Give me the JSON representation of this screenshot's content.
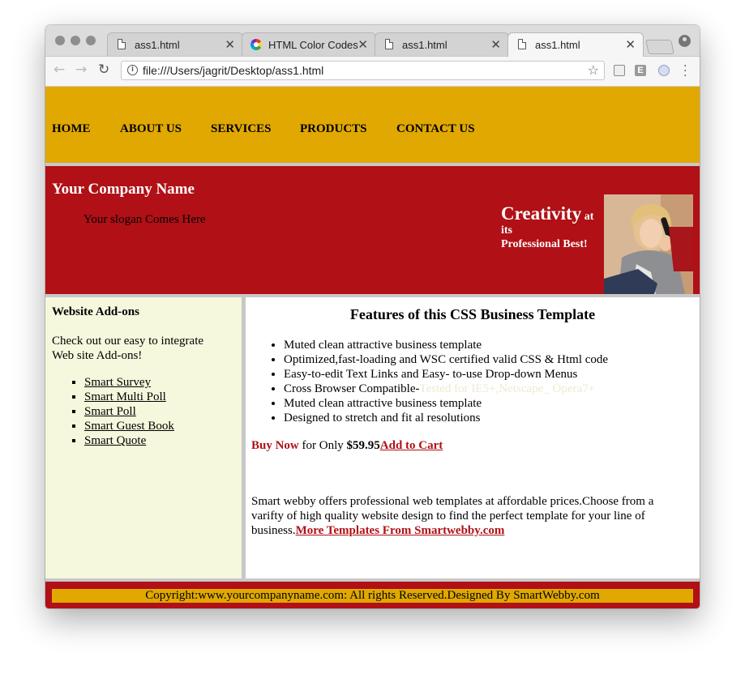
{
  "browser": {
    "tabs": [
      {
        "title": "ass1.html",
        "icon": "file-icon",
        "active": false
      },
      {
        "title": "HTML Color Codes",
        "icon": "color-wheel-icon",
        "active": false
      },
      {
        "title": "ass1.html",
        "icon": "file-icon",
        "active": false
      },
      {
        "title": "ass1.html",
        "icon": "file-icon",
        "active": true
      }
    ],
    "url": "file:///Users/jagrit/Desktop/ass1.html",
    "extension_e_label": "E"
  },
  "page": {
    "nav": [
      "HOME",
      "ABOUT US",
      "SERVICES",
      "PRODUCTS",
      "CONTACT US"
    ],
    "banner": {
      "company": "Your Company Name",
      "slogan": "Your slogan Comes Here",
      "creativity_big": "Creativity",
      "creativity_at": " at",
      "creativity_its": "its",
      "creativity_best": "Professional Best!"
    },
    "sidebar": {
      "title": "Website Add-ons",
      "intro": "Check out our easy to integrate Web site Add-ons!",
      "links": [
        "Smart Survey",
        "Smart Multi Poll",
        "Smart Poll",
        "Smart Guest Book",
        "Smart Quote"
      ]
    },
    "main": {
      "title": "Features of this CSS Business Template",
      "features": [
        "Muted clean attractive business template",
        "Optimized,fast-loading and WSC certified valid CSS & Html code",
        "Easy-to-edit Text Links and Easy- to-use Drop-down Menus",
        "Cross Browser Compatible-",
        "Muted clean attractive business template",
        "Designed to stretch and fit al resolutions"
      ],
      "compat_faint": "Tested for IE5+,Netscape_ Opera7+",
      "buy_now": "Buy Now",
      "for_only": " for Only ",
      "price": "$59.95",
      "add_to_cart": "Add to Cart",
      "about_text": "Smart webby offers professional web templates at affordable prices.Choose from a varifty of high quality website design to find the perfect template for your line of business.",
      "more_templates": "More Templates From Smartwebby.com"
    },
    "footer": "Copyright:www.yourcompanyname.com: All rights Reserved.Designed By SmartWebby.com"
  },
  "colors": {
    "nav_bg": "#e1a801",
    "banner_bg": "#b01016",
    "sidebar_bg": "#f5f8dd",
    "accent_link": "#b01016"
  }
}
